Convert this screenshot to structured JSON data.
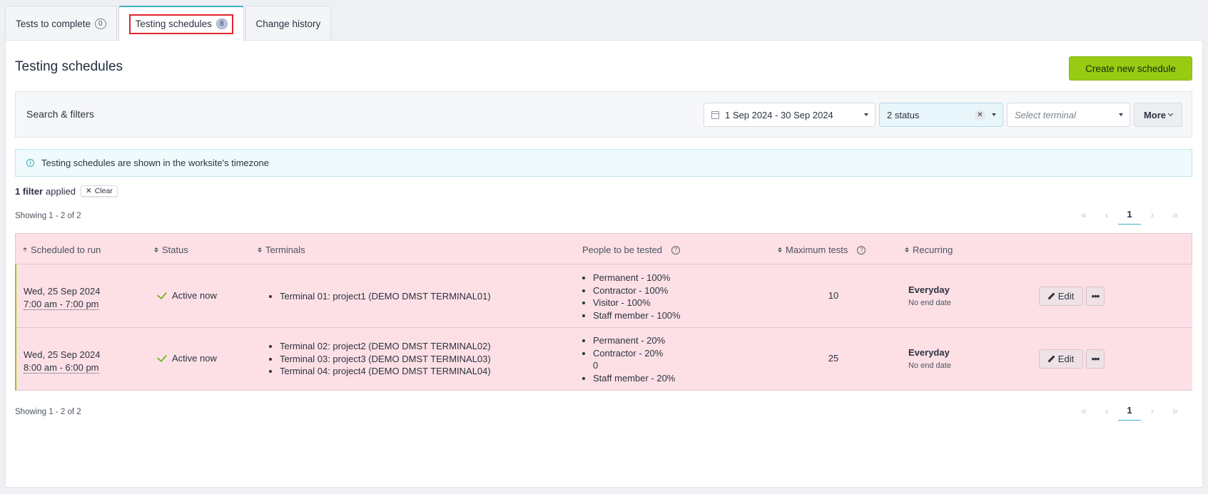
{
  "tabs": [
    {
      "label": "Tests to complete",
      "count": "0"
    },
    {
      "label": "Testing schedules",
      "count": "8"
    },
    {
      "label": "Change history"
    }
  ],
  "page": {
    "title": "Testing schedules",
    "create_label": "Create new schedule"
  },
  "filters": {
    "label": "Search & filters",
    "date_range": "1 Sep 2024 - 30 Sep 2024",
    "status": "2 status",
    "terminal_placeholder": "Select terminal",
    "more_label": "More"
  },
  "notice": {
    "text": "Testing schedules are shown in the worksite's timezone"
  },
  "applied": {
    "count": "1 filter",
    "suffix": "applied",
    "clear_label": "Clear"
  },
  "pagination": {
    "showing": "Showing 1 - 2 of 2",
    "current_page": "1"
  },
  "table": {
    "columns": {
      "scheduled": "Scheduled to run",
      "status": "Status",
      "terminals": "Terminals",
      "people": "People to be tested",
      "max_tests": "Maximum tests",
      "recurring": "Recurring"
    },
    "rows": [
      {
        "date": "Wed, 25 Sep 2024",
        "time": "7:00 am - 7:00 pm",
        "status": "Active now",
        "terminals": [
          "Terminal 01: project1 (DEMO DMST TERMINAL01)"
        ],
        "people": [
          "Permanent - 100%",
          "Contractor - 100%",
          "Visitor - 100%",
          "Staff member - 100%"
        ],
        "max_tests": "10",
        "recurring": "Everyday",
        "end": "No end date",
        "edit_label": "Edit"
      },
      {
        "date": "Wed, 25 Sep 2024",
        "time": "8:00 am - 6:00 pm",
        "status": "Active now",
        "terminals": [
          "Terminal 02: project2 (DEMO DMST TERMINAL02)",
          "Terminal 03: project3 (DEMO DMST TERMINAL03)",
          "Terminal 04: project4 (DEMO DMST TERMINAL04)"
        ],
        "people": [
          "Permanent - 20%",
          "Contractor - 20%",
          "0",
          "Staff member - 20%"
        ],
        "max_tests": "25",
        "recurring": "Everyday",
        "end": "No end date",
        "edit_label": "Edit"
      }
    ]
  },
  "colors": {
    "accent": "#3fb0c9",
    "primary_button": "#97cc12",
    "row_highlight": "#fde0e6",
    "active_check": "#7bb82a",
    "tab_outline": "#e2232a"
  }
}
